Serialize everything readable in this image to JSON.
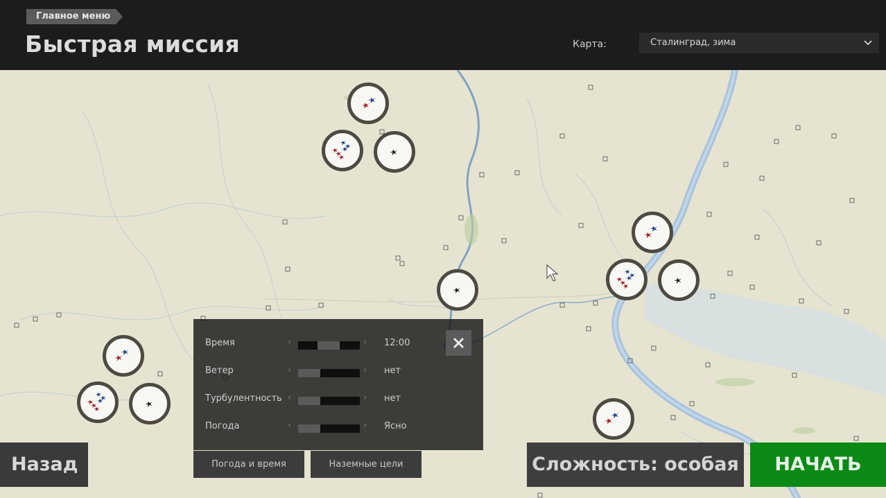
{
  "header": {
    "breadcrumb": "Главное меню",
    "title": "Быстрая миссия",
    "map_label": "Карта:",
    "map_value": "Сталинград, зима"
  },
  "settings": {
    "rows": [
      {
        "label": "Время",
        "value": "12:00",
        "level": 0.55
      },
      {
        "label": "Ветер",
        "value": "нет",
        "level": 0.35
      },
      {
        "label": "Турбулентность",
        "value": "нет",
        "level": 0.35
      },
      {
        "label": "Погода",
        "value": "Ясно",
        "level": 0.35
      }
    ]
  },
  "tabs": {
    "weather_time": "Погода и время",
    "ground_targets": "Наземные цели"
  },
  "buttons": {
    "back": "Назад",
    "difficulty": "Сложность: особая",
    "start": "НАЧАТЬ"
  },
  "colors": {
    "allied_aircraft": "#1f3f82",
    "enemy_aircraft": "#9c1d22",
    "neutral_aircraft": "#1b1b1b",
    "start_button": "#0c8a16",
    "river": "#a9c3dc",
    "land": "#e6e4d0"
  }
}
